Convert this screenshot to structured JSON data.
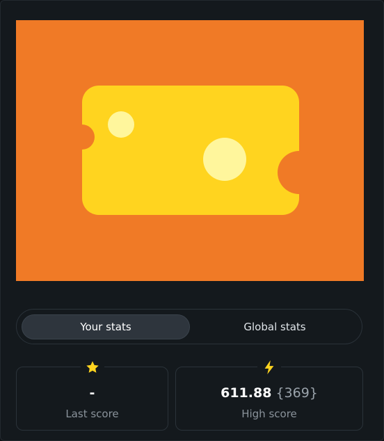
{
  "game": {
    "colors": {
      "background": "#f07a26",
      "cheese": "#ffd41f",
      "holes": "#fff69c"
    },
    "icon": "cheese-icon"
  },
  "tabs": [
    {
      "label": "Your stats",
      "selected": true
    },
    {
      "label": "Global stats",
      "selected": false
    }
  ],
  "stats": {
    "last_score": {
      "icon": "star-icon",
      "value": "-",
      "label": "Last score"
    },
    "high_score": {
      "icon": "lightning-icon",
      "value": "611.88",
      "rank": "{369}",
      "label": "High score"
    }
  },
  "colors": {
    "accent": "#ffd41f",
    "panel": "#14191d",
    "border": "#2b333a"
  }
}
